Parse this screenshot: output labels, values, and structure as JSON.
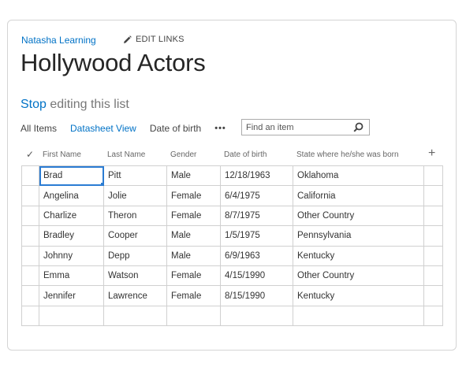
{
  "breadcrumb": "Natasha Learning",
  "edit_links": {
    "label": "EDIT LINKS",
    "icon": "pencil-icon"
  },
  "title": "Hollywood Actors",
  "editing": {
    "stop": "Stop",
    "rest": " editing this list"
  },
  "views": [
    {
      "label": "All Items",
      "active": false
    },
    {
      "label": "Datasheet View",
      "active": true
    },
    {
      "label": "Date of birth",
      "active": false
    }
  ],
  "more": "•••",
  "search": {
    "placeholder": "Find an item",
    "icon": "search-icon"
  },
  "grid": {
    "checkmark": "✓",
    "add": "+",
    "columns": [
      "First Name",
      "Last Name",
      "Gender",
      "Date of birth",
      "State where he/she was born"
    ],
    "rows": [
      [
        "Brad",
        "Pitt",
        "Male",
        "12/18/1963",
        "Oklahoma"
      ],
      [
        "Angelina",
        "Jolie",
        "Female",
        "6/4/1975",
        "California"
      ],
      [
        "Charlize",
        "Theron",
        "Female",
        "8/7/1975",
        "Other Country"
      ],
      [
        "Bradley",
        "Cooper",
        "Male",
        "1/5/1975",
        "Pennsylvania"
      ],
      [
        "Johnny",
        "Depp",
        "Male",
        "6/9/1963",
        "Kentucky"
      ],
      [
        "Emma",
        "Watson",
        "Female",
        "4/15/1990",
        "Other Country"
      ],
      [
        "Jennifer",
        "Lawrence",
        "Female",
        "8/15/1990",
        "Kentucky"
      ],
      [
        "",
        "",
        "",
        "",
        ""
      ]
    ],
    "selected_cell": "Brad"
  },
  "colors": {
    "link": "#0072c6",
    "selection": "#2b7cd3",
    "border": "#d0d0d0"
  }
}
